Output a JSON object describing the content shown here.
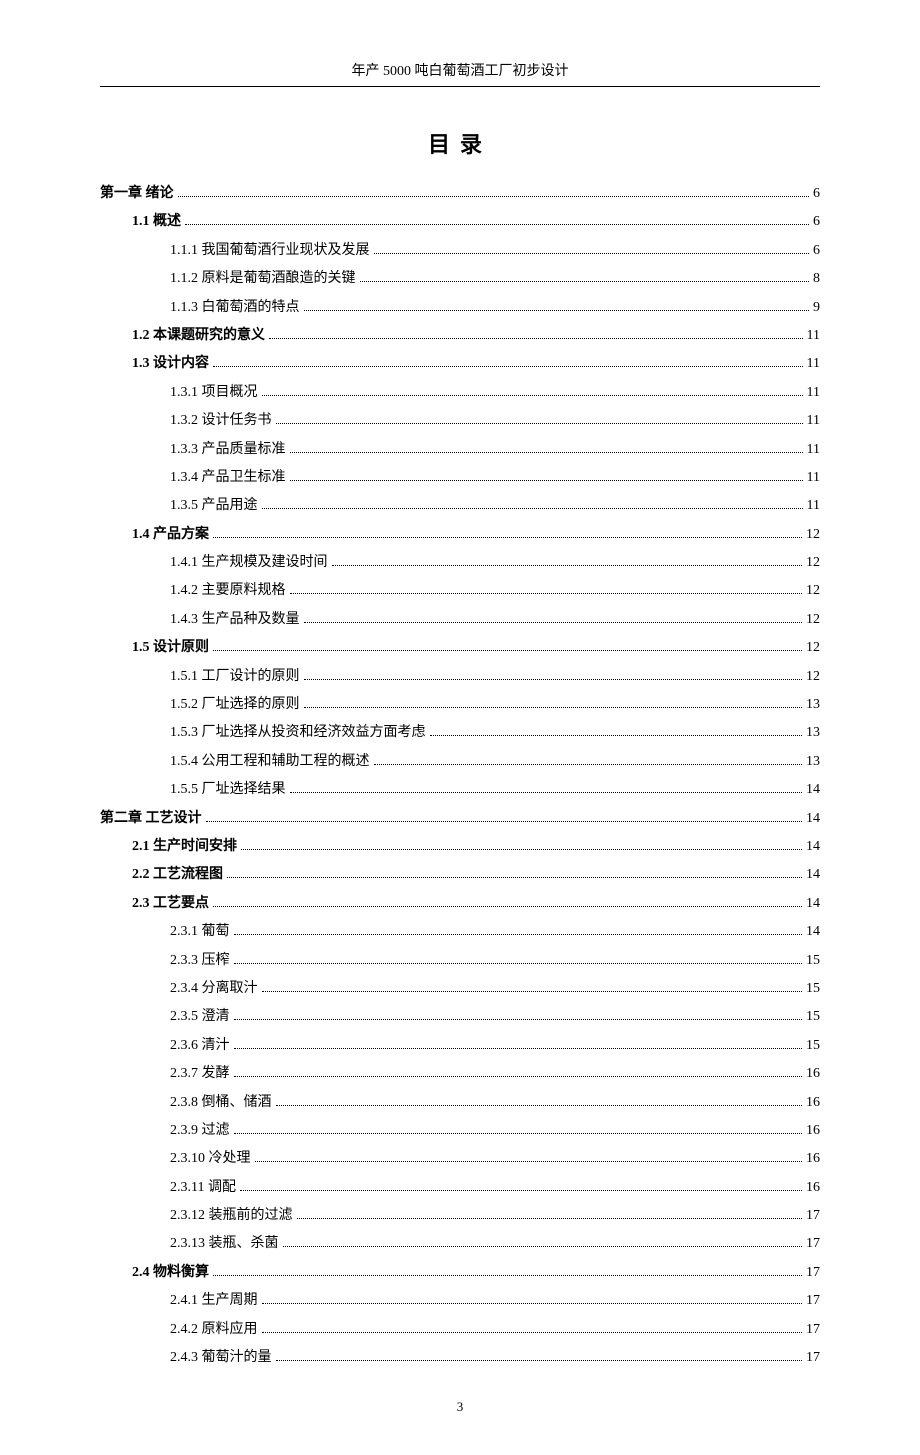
{
  "header_title": "年产 5000 吨白葡萄酒工厂初步设计",
  "toc_title": "目录",
  "page_number": "3",
  "entries": [
    {
      "level": 0,
      "label": "第一章 绪论",
      "page": "6"
    },
    {
      "level": 1,
      "label": "1.1 概述",
      "page": "6"
    },
    {
      "level": 2,
      "label": "1.1.1 我国葡萄酒行业现状及发展",
      "page": "6"
    },
    {
      "level": 2,
      "label": "1.1.2 原料是葡萄酒酿造的关键",
      "page": "8"
    },
    {
      "level": 2,
      "label": "1.1.3 白葡萄酒的特点",
      "page": "9"
    },
    {
      "level": 1,
      "label": "1.2 本课题研究的意义",
      "page": "11"
    },
    {
      "level": 1,
      "label": "1.3 设计内容",
      "page": "11"
    },
    {
      "level": 2,
      "label": "1.3.1 项目概况",
      "page": "11"
    },
    {
      "level": 2,
      "label": "1.3.2 设计任务书",
      "page": "11"
    },
    {
      "level": 2,
      "label": "1.3.3 产品质量标准",
      "page": "11"
    },
    {
      "level": 2,
      "label": "1.3.4 产品卫生标准",
      "page": "11"
    },
    {
      "level": 2,
      "label": "1.3.5 产品用途",
      "page": "11"
    },
    {
      "level": 1,
      "label": "1.4 产品方案",
      "page": "12"
    },
    {
      "level": 2,
      "label": "1.4.1 生产规模及建设时间",
      "page": "12"
    },
    {
      "level": 2,
      "label": "1.4.2 主要原料规格",
      "page": "12"
    },
    {
      "level": 2,
      "label": "1.4.3 生产品种及数量",
      "page": "12"
    },
    {
      "level": 1,
      "label": "1.5 设计原则",
      "page": "12"
    },
    {
      "level": 2,
      "label": "1.5.1 工厂设计的原则",
      "page": "12"
    },
    {
      "level": 2,
      "label": "1.5.2 厂址选择的原则",
      "page": "13"
    },
    {
      "level": 2,
      "label": "1.5.3 厂址选择从投资和经济效益方面考虑",
      "page": "13"
    },
    {
      "level": 2,
      "label": "1.5.4 公用工程和辅助工程的概述",
      "page": "13"
    },
    {
      "level": 2,
      "label": "1.5.5 厂址选择结果",
      "page": "14"
    },
    {
      "level": 0,
      "label": "第二章 工艺设计",
      "page": "14"
    },
    {
      "level": 1,
      "label": "2.1 生产时间安排",
      "page": "14"
    },
    {
      "level": 1,
      "label": "2.2 工艺流程图",
      "page": "14"
    },
    {
      "level": 1,
      "label": "2.3 工艺要点",
      "page": "14"
    },
    {
      "level": 2,
      "label": "2.3.1 葡萄",
      "page": "14"
    },
    {
      "level": 2,
      "label": "2.3.3 压榨",
      "page": "15"
    },
    {
      "level": 2,
      "label": "2.3.4 分离取汁",
      "page": "15"
    },
    {
      "level": 2,
      "label": "2.3.5 澄清",
      "page": "15"
    },
    {
      "level": 2,
      "label": "2.3.6 清汁",
      "page": "15"
    },
    {
      "level": 2,
      "label": "2.3.7 发酵",
      "page": "16"
    },
    {
      "level": 2,
      "label": "2.3.8 倒桶、储酒",
      "page": "16"
    },
    {
      "level": 2,
      "label": "2.3.9 过滤",
      "page": "16"
    },
    {
      "level": 2,
      "label": "2.3.10 冷处理",
      "page": "16"
    },
    {
      "level": 2,
      "label": "2.3.11 调配",
      "page": "16"
    },
    {
      "level": 2,
      "label": "2.3.12 装瓶前的过滤",
      "page": "17"
    },
    {
      "level": 2,
      "label": "2.3.13 装瓶、杀菌",
      "page": "17"
    },
    {
      "level": 1,
      "label": "2.4 物料衡算",
      "page": "17"
    },
    {
      "level": 2,
      "label": "2.4.1 生产周期",
      "page": "17"
    },
    {
      "level": 2,
      "label": "2.4.2 原料应用",
      "page": "17"
    },
    {
      "level": 2,
      "label": "2.4.3 葡萄汁的量",
      "page": "17"
    }
  ]
}
